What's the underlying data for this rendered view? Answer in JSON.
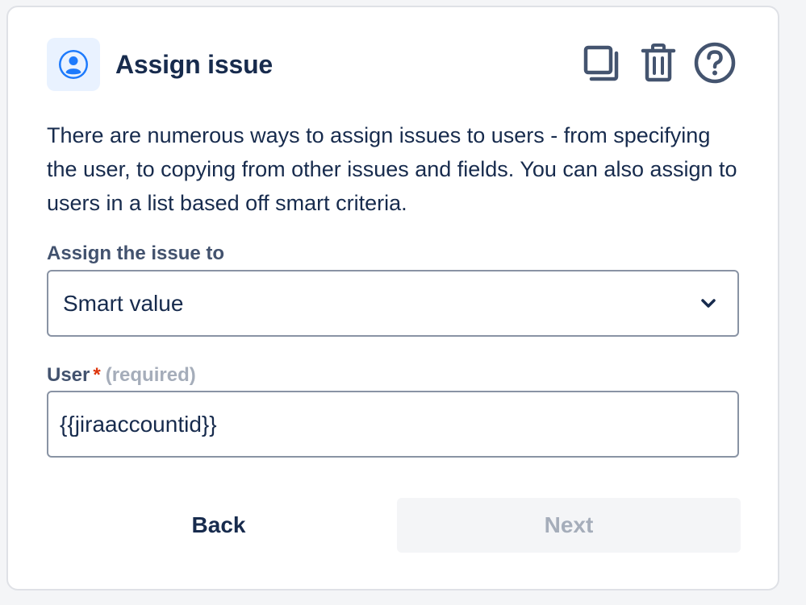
{
  "header": {
    "title": "Assign issue",
    "icon": "user-avatar-icon",
    "actions": [
      {
        "name": "duplicate",
        "icon": "copy-icon"
      },
      {
        "name": "delete",
        "icon": "trash-icon"
      },
      {
        "name": "help",
        "icon": "help-icon"
      }
    ]
  },
  "description": "There are numerous ways to assign issues to users - from specifying the user, to copying from other issues and fields. You can also assign to users in a list based off smart criteria.",
  "assign_field": {
    "label": "Assign the issue to",
    "selected_value": "Smart value"
  },
  "user_field": {
    "label": "User",
    "required_marker": "*",
    "required_hint": "(required)",
    "value": "{{jiraaccountid}}"
  },
  "footer": {
    "back_label": "Back",
    "next_label": "Next"
  },
  "colors": {
    "accent": "#0c66e4",
    "icon_bg": "#e9f2ff",
    "required": "#de350b",
    "text": "#172b4d",
    "muted": "#a5adba"
  }
}
